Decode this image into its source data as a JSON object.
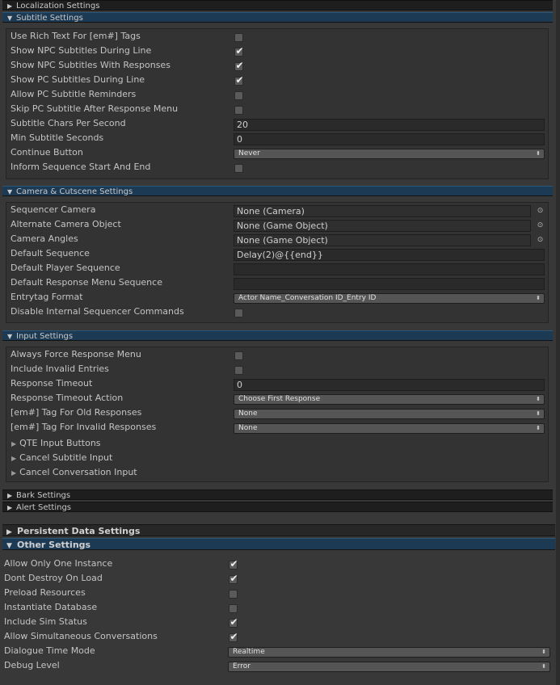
{
  "sections": {
    "localization": "Localization Settings",
    "subtitle": "Subtitle Settings",
    "camera": "Camera & Cutscene Settings",
    "input": "Input Settings",
    "bark": "Bark Settings",
    "alert": "Alert Settings",
    "persistent": "Persistent Data Settings",
    "other": "Other Settings"
  },
  "subtitle": {
    "use_rich_text": {
      "label": "Use Rich Text For [em#] Tags",
      "checked": false
    },
    "show_npc_during_line": {
      "label": "Show NPC Subtitles During Line",
      "checked": true
    },
    "show_npc_with_responses": {
      "label": "Show NPC Subtitles With Responses",
      "checked": true
    },
    "show_pc_during_line": {
      "label": "Show PC Subtitles During Line",
      "checked": true
    },
    "allow_pc_reminders": {
      "label": "Allow PC Subtitle Reminders",
      "checked": false
    },
    "skip_pc_after_response": {
      "label": "Skip PC Subtitle After Response Menu",
      "checked": false
    },
    "chars_per_second": {
      "label": "Subtitle Chars Per Second",
      "value": "20"
    },
    "min_seconds": {
      "label": "Min Subtitle Seconds",
      "value": "0"
    },
    "continue_button": {
      "label": "Continue Button",
      "value": "Never"
    },
    "inform_sequence": {
      "label": "Inform Sequence Start And End",
      "checked": false
    }
  },
  "camera": {
    "sequencer_camera": {
      "label": "Sequencer Camera",
      "value": "None (Camera)"
    },
    "alternate_camera": {
      "label": "Alternate Camera Object",
      "value": "None (Game Object)"
    },
    "camera_angles": {
      "label": "Camera Angles",
      "value": "None (Game Object)"
    },
    "default_sequence": {
      "label": "Default Sequence",
      "value": "Delay(2)@{{end}}"
    },
    "default_player_sequence": {
      "label": "Default Player Sequence",
      "value": ""
    },
    "default_response_menu_sequence": {
      "label": "Default Response Menu Sequence",
      "value": ""
    },
    "entrytag_format": {
      "label": "Entrytag Format",
      "value": "Actor Name_Conversation ID_Entry ID"
    },
    "disable_internal": {
      "label": "Disable Internal Sequencer Commands",
      "checked": false
    }
  },
  "input": {
    "always_force": {
      "label": "Always Force Response Menu",
      "checked": false
    },
    "include_invalid": {
      "label": "Include Invalid Entries",
      "checked": false
    },
    "response_timeout": {
      "label": "Response Timeout",
      "value": "0"
    },
    "timeout_action": {
      "label": "Response Timeout Action",
      "value": "Choose First Response"
    },
    "em_tag_old": {
      "label": "[em#] Tag For Old Responses",
      "value": "None"
    },
    "em_tag_invalid": {
      "label": "[em#] Tag For Invalid Responses",
      "value": "None"
    },
    "qte_buttons": "QTE Input Buttons",
    "cancel_subtitle": "Cancel Subtitle Input",
    "cancel_conversation": "Cancel Conversation Input"
  },
  "other": {
    "allow_one_instance": {
      "label": "Allow Only One Instance",
      "checked": true
    },
    "dont_destroy": {
      "label": "Dont Destroy On Load",
      "checked": true
    },
    "preload_resources": {
      "label": "Preload Resources",
      "checked": false
    },
    "instantiate_database": {
      "label": "Instantiate Database",
      "checked": false
    },
    "include_sim_status": {
      "label": "Include Sim Status",
      "checked": true
    },
    "allow_simultaneous": {
      "label": "Allow Simultaneous Conversations",
      "checked": true
    },
    "dialogue_time_mode": {
      "label": "Dialogue Time Mode",
      "value": "Realtime"
    },
    "debug_level": {
      "label": "Debug Level",
      "value": "Error"
    }
  },
  "icons": {
    "collapsed": "▶",
    "expanded": "▼",
    "checkmark": "✔",
    "dropdown": "⬍",
    "object_picker": "⊙"
  }
}
